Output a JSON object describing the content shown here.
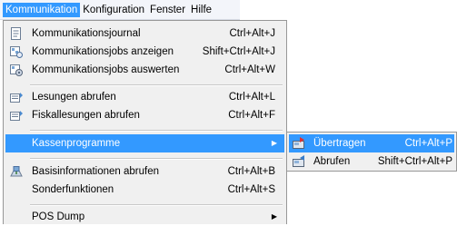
{
  "menubar": {
    "items": [
      {
        "label": "Kommunikation"
      },
      {
        "label": "Konfiguration"
      },
      {
        "label": "Fenster"
      },
      {
        "label": "Hilfe"
      }
    ]
  },
  "menu": {
    "items": [
      {
        "label": "Kommunikationsjournal",
        "shortcut": "Ctrl+Alt+J",
        "icon": "journal-icon"
      },
      {
        "label": "Kommunikationsjobs anzeigen",
        "shortcut": "Shift+Ctrl+Alt+J",
        "icon": "jobs-view-icon"
      },
      {
        "label": "Kommunikationsjobs auswerten",
        "shortcut": "Ctrl+Alt+W",
        "icon": "jobs-evaluate-icon"
      },
      {
        "label": "Lesungen abrufen",
        "shortcut": "Ctrl+Alt+L",
        "icon": "readings-icon"
      },
      {
        "label": "Fiskallesungen abrufen",
        "shortcut": "Ctrl+Alt+F",
        "icon": "fiscal-readings-icon"
      },
      {
        "label": "Kassenprogramme",
        "shortcut": "",
        "icon": ""
      },
      {
        "label": "Basisinformationen abrufen",
        "shortcut": "Ctrl+Alt+B",
        "icon": "base-info-icon"
      },
      {
        "label": "Sonderfunktionen",
        "shortcut": "Ctrl+Alt+S",
        "icon": ""
      },
      {
        "label": "POS Dump",
        "shortcut": "",
        "icon": ""
      }
    ]
  },
  "submenu": {
    "items": [
      {
        "label": "Übertragen",
        "shortcut": "Ctrl+Alt+P",
        "icon": "transfer-icon"
      },
      {
        "label": "Abrufen",
        "shortcut": "Shift+Ctrl+Alt+P",
        "icon": "retrieve-icon"
      }
    ]
  },
  "colors": {
    "highlight": "#3399ff",
    "menu_bg": "#f0f0f0"
  }
}
